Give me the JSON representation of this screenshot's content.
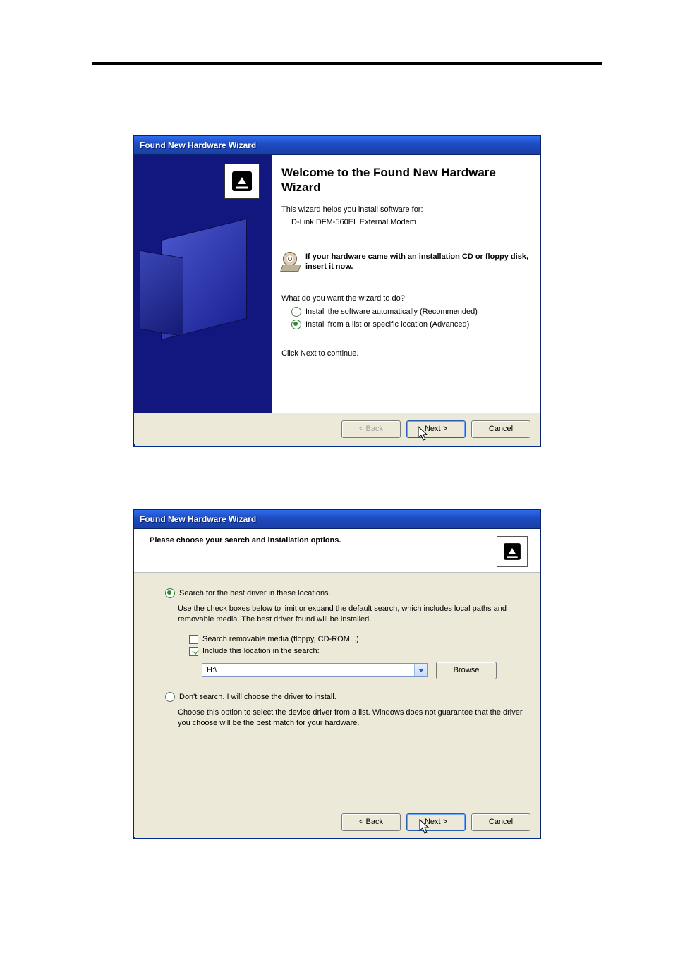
{
  "dialog1": {
    "title": "Found New Hardware Wizard",
    "heading": "Welcome to the Found New Hardware Wizard",
    "intro": "This wizard helps you install software for:",
    "device": "D-Link DFM-560EL External Modem",
    "cd_text": "If your hardware came with an installation CD or floppy disk, insert it now.",
    "question": "What do you want the wizard to do?",
    "option_auto": "Install the software automatically (Recommended)",
    "option_list": "Install from a list or specific location (Advanced)",
    "continue": "Click Next to continue.",
    "buttons": {
      "back": "< Back",
      "next": "Next >",
      "cancel": "Cancel"
    }
  },
  "dialog2": {
    "title": "Found New Hardware Wizard",
    "subtitle": "Please choose your search and installation options.",
    "opt_search": "Search for the best driver in these locations.",
    "search_desc": "Use the check boxes below to limit or expand the default search, which includes local paths and removable media. The best driver found will be installed.",
    "chk_removable": "Search removable media (floppy, CD-ROM...)",
    "chk_include": "Include this location in the search:",
    "location_value": "H:\\",
    "browse": "Browse",
    "opt_nosearch": "Don't search. I will choose the driver to install.",
    "nosearch_desc": "Choose this option to select the device driver from a list.  Windows does not guarantee that the driver you choose will be the best match for your hardware.",
    "buttons": {
      "back": "< Back",
      "next": "Next >",
      "cancel": "Cancel"
    }
  }
}
